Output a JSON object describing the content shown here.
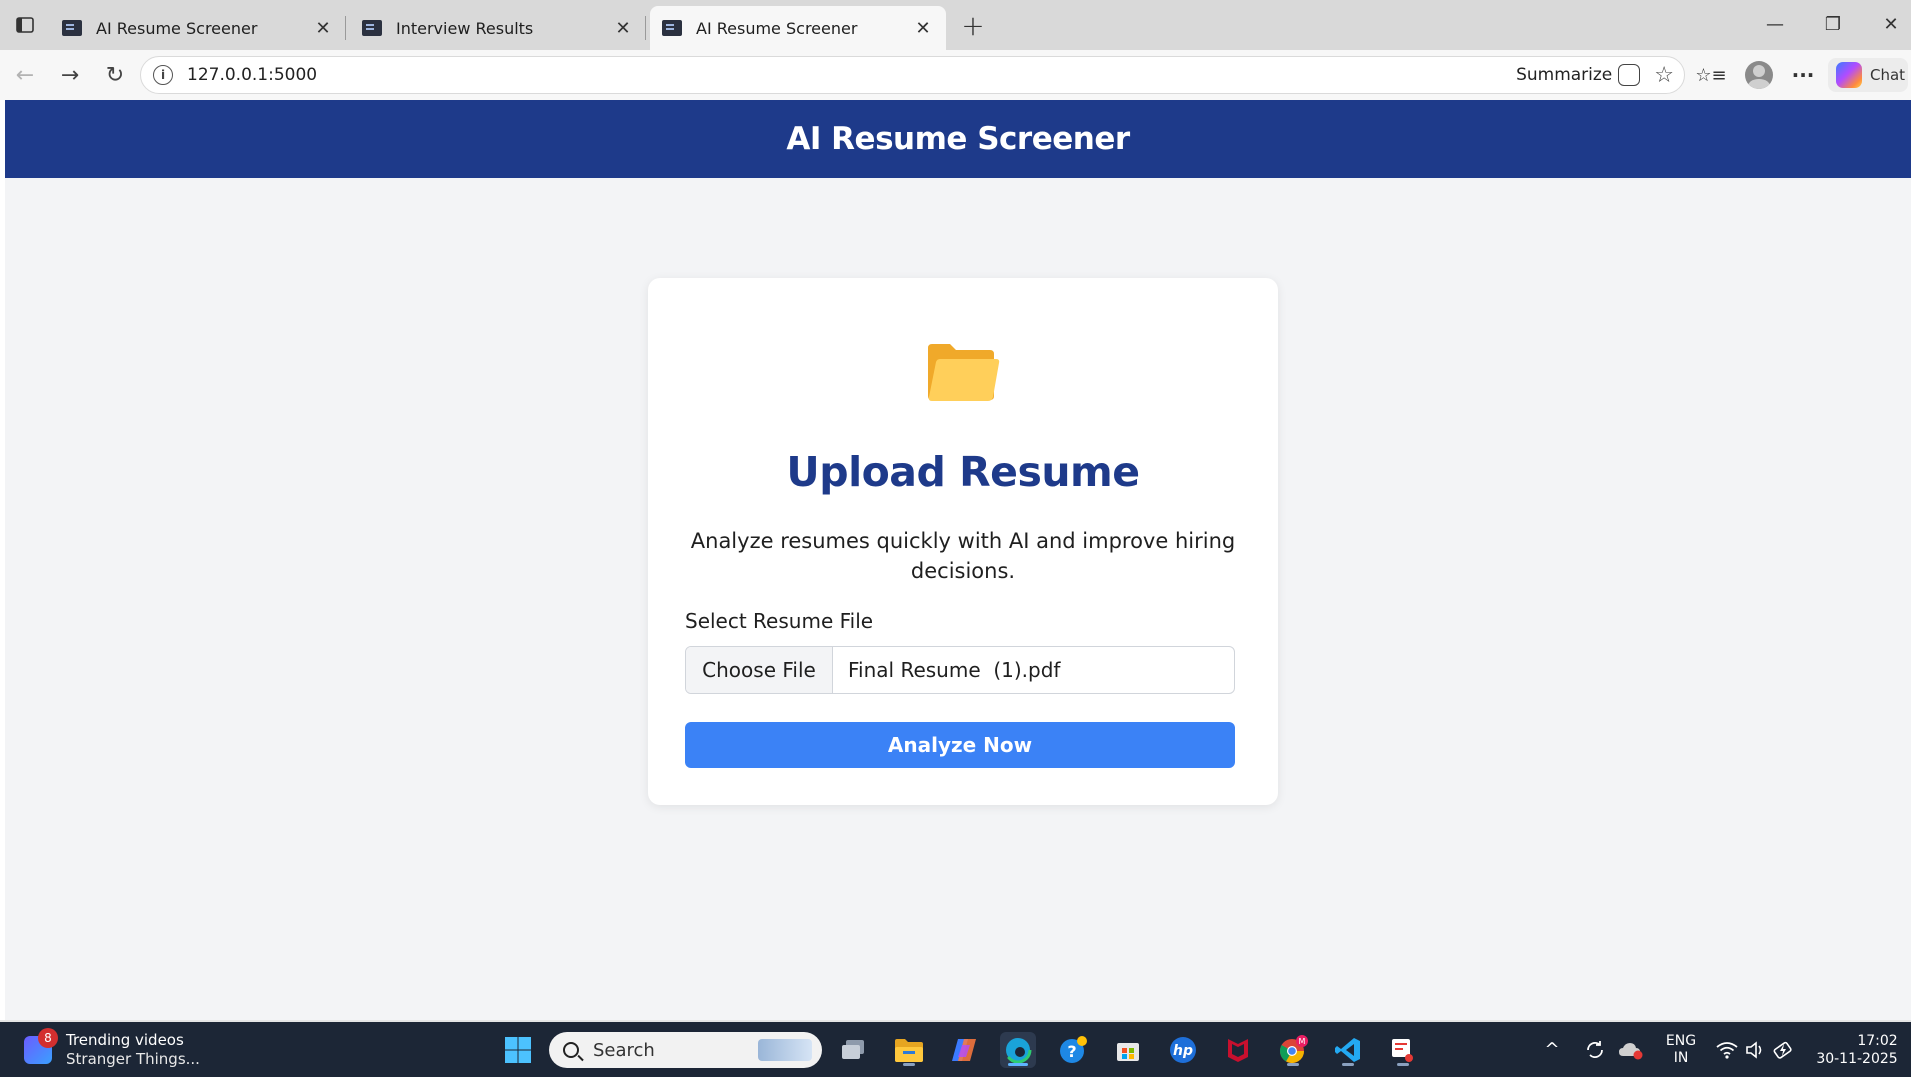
{
  "browser": {
    "tabs": [
      {
        "title": "AI Resume Screener",
        "active": false
      },
      {
        "title": "Interview Results",
        "active": false
      },
      {
        "title": "AI Resume Screener",
        "active": true
      }
    ],
    "tab_close_glyph": "✕",
    "new_tab_glyph": "+",
    "window_controls": {
      "minimize": "—",
      "restore": "❐",
      "close": "✕"
    },
    "nav": {
      "back": "←",
      "forward": "→",
      "reload": "↻"
    },
    "address": {
      "url": "127.0.0.1:5000",
      "info_glyph": "i"
    },
    "summarize_label": "Summarize",
    "star_glyph": "☆",
    "favorites_glyph": "☆≡",
    "more_glyph": "···",
    "chat_label": "Chat"
  },
  "page": {
    "header_title": "AI Resume Screener",
    "card": {
      "icon": "folder-icon",
      "title": "Upload Resume",
      "description": "Analyze resumes quickly with AI and improve hiring decisions.",
      "field_label": "Select Resume File",
      "choose_button": "Choose File",
      "file_name": "Final Resume  (1).pdf",
      "submit_button": "Analyze Now"
    },
    "colors": {
      "header": "#1e3a8a",
      "title": "#1e3a8a",
      "button": "#3b82f6",
      "background": "#f3f4f6"
    }
  },
  "taskbar": {
    "news": {
      "badge": "8",
      "title": "Trending videos",
      "subtitle": "Stranger Things..."
    },
    "search_placeholder": "Search",
    "apps": [
      "windows-start-icon",
      "task-view-icon",
      "file-explorer-icon",
      "copilot-icon",
      "edge-icon",
      "help-icon",
      "store-icon",
      "hp-icon",
      "mcafee-icon",
      "chrome-icon",
      "vscode-icon",
      "snipping-tool-icon"
    ],
    "chrome_badge": "M",
    "tray": {
      "chevron": "^",
      "lang_top": "ENG",
      "lang_bottom": "IN",
      "time": "17:02",
      "date": "30-11-2025"
    }
  }
}
